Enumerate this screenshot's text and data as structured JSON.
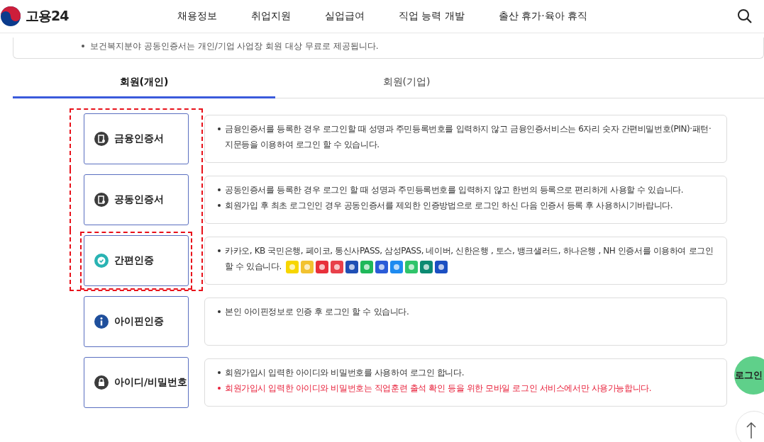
{
  "header": {
    "logo_text": "고용24",
    "nav": [
      "채용정보",
      "취업지원",
      "실업급여",
      "직업 능력 개발",
      "출산 휴가·육아 휴직"
    ]
  },
  "notice": "보건복지분야 공동인증서는 개인/기업 사업장 회원 대상 무료로 제공됩니다.",
  "tabs": [
    {
      "label": "회원(개인)",
      "selected": true
    },
    {
      "label": "회원(기업)",
      "selected": false
    }
  ],
  "methods": [
    {
      "kind": "certificate",
      "label": "금융인증서",
      "framed": true,
      "highlighted": false,
      "lines": [
        {
          "text": "금융인증서를 등록한 경우 로그인할 때 성명과 주민등록번호를 입력하지 않고 금융인증서비스는 6자리 숫자 간편비밀번호(PIN)·패턴·지문등을 이용하여 로그인 할 수 있습니다.",
          "warning": false
        }
      ]
    },
    {
      "kind": "certificate",
      "label": "공동인증서",
      "framed": true,
      "highlighted": false,
      "lines": [
        {
          "text": "공동인증서를 등록한 경우 로그인 할 때 성명과 주민등록번호를 입력하지 않고 한번의 등록으로 편리하게 사용할 수 있습니다.",
          "warning": false
        },
        {
          "text": "회원가입 후 최초 로그인인 경우 공동인증서를 제외한 인증방법으로 로그인 하신 다음 인증서 등록 후 사용하시기바랍니다.",
          "warning": false
        }
      ]
    },
    {
      "kind": "simple",
      "label": "간편인증",
      "framed": true,
      "highlighted": true,
      "lines": [
        {
          "text": "카카오, KB 국민은행, 페이코, 통신사PASS, 삼성PASS, 네이버, 신한은행 , 토스, 뱅크샐러드, 하나은행 , NH 인증서를 이용하여 로그인 할 수 있습니다.",
          "warning": false
        }
      ],
      "logos": [
        {
          "color": "#f7d600"
        },
        {
          "color": "#f2c230"
        },
        {
          "color": "#e8303a"
        },
        {
          "color": "#e8404a"
        },
        {
          "color": "#1f4fb5"
        },
        {
          "color": "#1fb85a"
        },
        {
          "color": "#2a5bd7"
        },
        {
          "color": "#1e8bf0"
        },
        {
          "color": "#2fc46a"
        },
        {
          "color": "#0b8a72"
        },
        {
          "color": "#1b4fc2"
        }
      ]
    },
    {
      "kind": "ipin",
      "label": "아이핀인증",
      "framed": false,
      "highlighted": false,
      "lines": [
        {
          "text": "본인 아이핀정보로 인증 후 로그인 할 수 있습니다.",
          "warning": false
        }
      ]
    },
    {
      "kind": "idpw",
      "label": "아이디/비밀번호",
      "framed": false,
      "highlighted": false,
      "lines": [
        {
          "text": "회원가입시 입력한 아이디와 비밀번호를 사용하여 로그인 합니다.",
          "warning": false
        },
        {
          "text": "회원가입시 입력한 아이디와 비밀번호는 직업훈련 출석 확인 등을 위한 모바일 로그인 서비스에서만 사용가능합니다.",
          "warning": true
        }
      ]
    }
  ],
  "floating": {
    "login": "로그인"
  }
}
